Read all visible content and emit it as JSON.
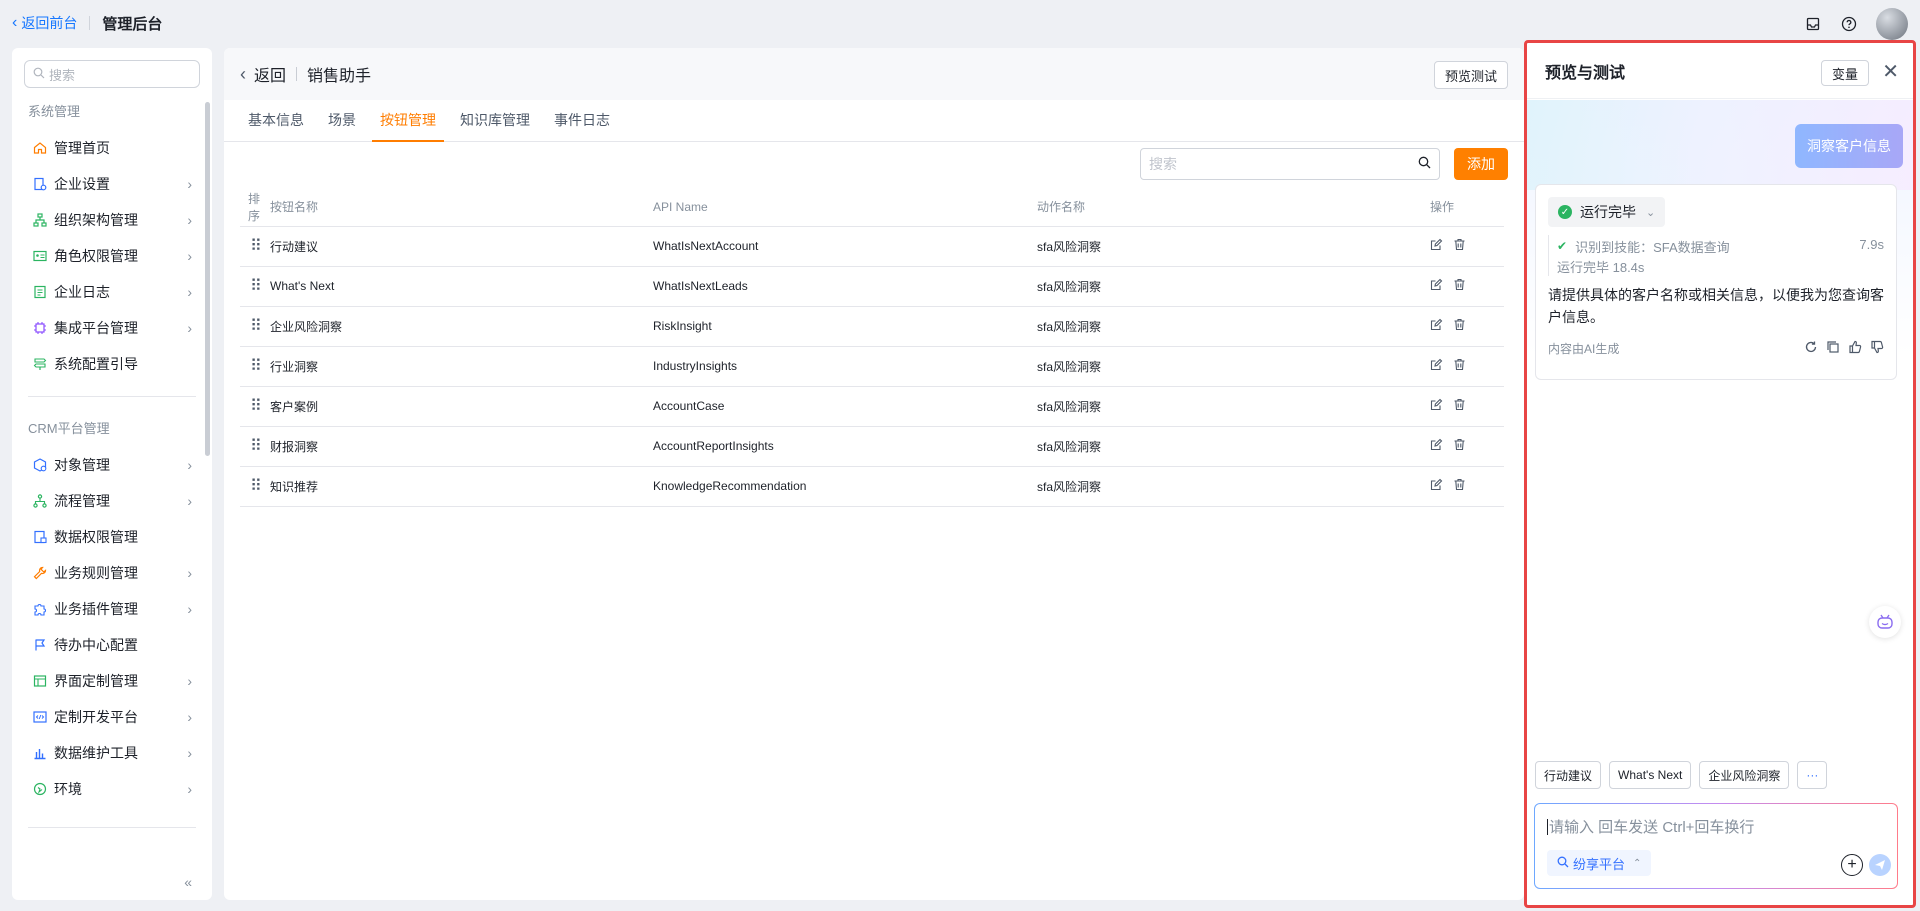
{
  "topbar": {
    "back_label": "返回前台",
    "title": "管理后台"
  },
  "sidebar": {
    "search_placeholder": "搜索",
    "group1": "系统管理",
    "items1": [
      {
        "label": "管理首页",
        "icon": "home-icon",
        "arrow": false
      },
      {
        "label": "企业设置",
        "icon": "building-icon",
        "arrow": true
      },
      {
        "label": "组织架构管理",
        "icon": "org-tree-icon",
        "arrow": true
      },
      {
        "label": "角色权限管理",
        "icon": "id-card-icon",
        "arrow": true
      },
      {
        "label": "企业日志",
        "icon": "log-icon",
        "arrow": true
      },
      {
        "label": "集成平台管理",
        "icon": "chip-icon",
        "arrow": true
      },
      {
        "label": "系统配置引导",
        "icon": "signpost-icon",
        "arrow": false
      }
    ],
    "group2": "CRM平台管理",
    "items2": [
      {
        "label": "对象管理",
        "icon": "cube-icon",
        "arrow": true
      },
      {
        "label": "流程管理",
        "icon": "flow-icon",
        "arrow": true
      },
      {
        "label": "数据权限管理",
        "icon": "data-lock-icon",
        "arrow": false
      },
      {
        "label": "业务规则管理",
        "icon": "wrench-icon",
        "arrow": true
      },
      {
        "label": "业务插件管理",
        "icon": "puzzle-icon",
        "arrow": true
      },
      {
        "label": "待办中心配置",
        "icon": "flag-icon",
        "arrow": false
      },
      {
        "label": "界面定制管理",
        "icon": "layout-icon",
        "arrow": true
      },
      {
        "label": "定制开发平台",
        "icon": "code-icon",
        "arrow": true
      },
      {
        "label": "数据维护工具",
        "icon": "bar-chart-icon",
        "arrow": true
      },
      {
        "label": "环境",
        "icon": "environment-icon",
        "arrow": true
      }
    ],
    "collapse_label": "«"
  },
  "main": {
    "back_label": "返回",
    "name": "销售助手",
    "preview_button": "预览测试",
    "tabs": [
      {
        "label": "基本信息",
        "active": false
      },
      {
        "label": "场景",
        "active": false
      },
      {
        "label": "按钮管理",
        "active": true
      },
      {
        "label": "知识库管理",
        "active": false
      },
      {
        "label": "事件日志",
        "active": false
      }
    ],
    "search_placeholder": "搜索",
    "add_button": "添加",
    "columns": {
      "order": "排序",
      "name": "按钮名称",
      "api": "API Name",
      "action": "动作名称",
      "ops": "操作"
    },
    "rows": [
      {
        "name": "行动建议",
        "api": "WhatIsNextAccount",
        "action": "sfa风险洞察"
      },
      {
        "name": "What's Next",
        "api": "WhatIsNextLeads",
        "action": "sfa风险洞察"
      },
      {
        "name": "企业风险洞察",
        "api": "RiskInsight",
        "action": "sfa风险洞察"
      },
      {
        "name": "行业洞察",
        "api": "IndustryInsights",
        "action": "sfa风险洞察"
      },
      {
        "name": "客户案例",
        "api": "AccountCase",
        "action": "sfa风险洞察"
      },
      {
        "name": "财报洞察",
        "api": "AccountReportInsights",
        "action": "sfa风险洞察"
      },
      {
        "name": "知识推荐",
        "api": "KnowledgeRecommendation",
        "action": "sfa风险洞察"
      }
    ]
  },
  "preview": {
    "title": "预览与测试",
    "var_button": "变量",
    "user_message": "洞察客户信息",
    "status": "运行完毕",
    "skill_text": "识别到技能：SFA数据查询",
    "skill_time": "7.9s",
    "run_text": "运行完毕 18.4s",
    "answer": "请提供具体的客户名称或相关信息，以便我为您查询客户信息。",
    "ai_note": "内容由AI生成",
    "quick_buttons": [
      "行动建议",
      "What's Next",
      "企业风险洞察"
    ],
    "more_label": "···",
    "input_placeholder": "请输入 回车发送 Ctrl+回车换行",
    "platform_chip": "纷享平台"
  },
  "colors": {
    "accent": "#ff8000",
    "link": "#1677ff",
    "highlight_border": "#e84545",
    "success": "#2bb461"
  }
}
